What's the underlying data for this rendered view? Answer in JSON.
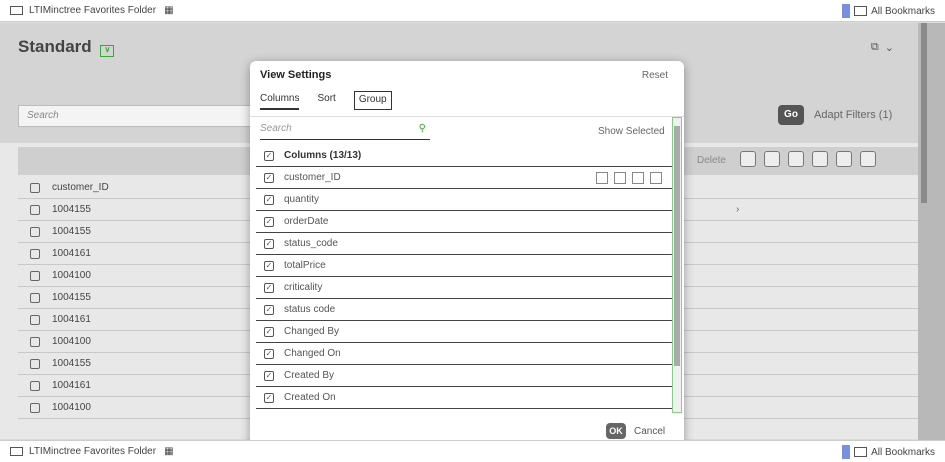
{
  "top_bar": {
    "folder_label": "LTIMinctree Favorites Folder",
    "bookmarks_label": "All Bookmarks"
  },
  "bottom_bar": {
    "folder_label": "LTIMinctree Favorites Folder",
    "bookmarks_label": "All Bookmarks"
  },
  "page": {
    "title": "Standard",
    "search_placeholder": "Search",
    "go_label": "Go",
    "adapt_filters_label": "Adapt Filters (1)",
    "delete_label": "Delete"
  },
  "table": {
    "column_header": "customer_ID",
    "rows": [
      "1004155",
      "1004155",
      "1004161",
      "1004100",
      "1004155",
      "1004161",
      "1004100",
      "1004155",
      "1004161",
      "1004100"
    ]
  },
  "dialog": {
    "title": "View Settings",
    "reset_label": "Reset",
    "tabs": [
      "Columns",
      "Sort",
      "Group"
    ],
    "search_placeholder": "Search",
    "show_selected_label": "Show Selected",
    "columns_header": "Columns (13/13)",
    "columns": [
      "customer_ID",
      "quantity",
      "orderDate",
      "status_code",
      "totalPrice",
      "criticality",
      "status code",
      "Changed By",
      "Changed On",
      "Created By",
      "Created On"
    ],
    "ok_label": "OK",
    "cancel_label": "Cancel"
  }
}
